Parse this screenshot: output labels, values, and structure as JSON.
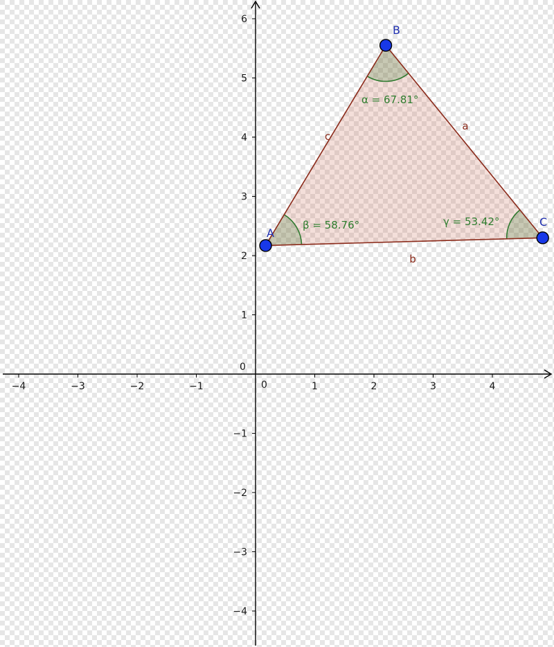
{
  "axes": {
    "x_ticks": [
      -4,
      -3,
      -2,
      -1,
      1,
      2,
      3,
      4
    ],
    "y_ticks": [
      -4,
      -3,
      -2,
      -1,
      1,
      2,
      3,
      4,
      5,
      6
    ],
    "x_tick_labels": [
      "−4",
      "−3",
      "−2",
      "−1",
      "1",
      "2",
      "3",
      "4"
    ],
    "y_tick_labels": [
      "−4",
      "−3",
      "−2",
      "−1",
      "1",
      "2",
      "3",
      "4",
      "5",
      "6"
    ],
    "x_zero_label": "0",
    "y_zero_label": "0"
  },
  "triangle": {
    "vertices": [
      {
        "label": "A",
        "x": 0.17,
        "y": 2.17
      },
      {
        "label": "B",
        "x": 2.2,
        "y": 5.55
      },
      {
        "label": "C",
        "x": 4.85,
        "y": 2.3
      }
    ],
    "sides": [
      {
        "label": "a",
        "from": "B",
        "to": "C"
      },
      {
        "label": "b",
        "from": "A",
        "to": "C"
      },
      {
        "label": "c",
        "from": "A",
        "to": "B"
      }
    ],
    "angles": [
      {
        "vertex": "B",
        "text": "α = 67.81°"
      },
      {
        "vertex": "A",
        "text": "β = 58.76°"
      },
      {
        "vertex": "C",
        "text": "γ = 53.42°"
      }
    ]
  },
  "colors": {
    "triangle_fill": "#cc6f55",
    "side_stroke": "#8b2a1a",
    "angle_green": "#2e7d2e",
    "point_fill": "#1838e8",
    "vertex_label": "#1f2fb0"
  }
}
